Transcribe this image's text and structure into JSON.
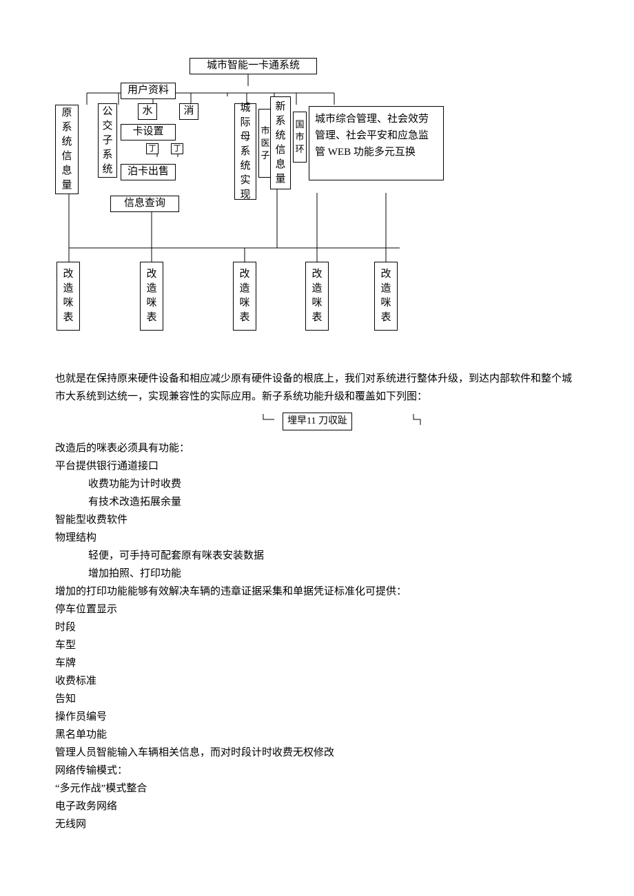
{
  "diagram": {
    "title": "城市智能一卡通系统",
    "userData": "用户资料",
    "cardSetting": "卡设置",
    "cardSale": "泊卡出售",
    "infoQuery": "信息查询",
    "leftTall": "原系统信息量",
    "col_gj": "公交子系统",
    "col_shui": "水",
    "col_xiao": "消",
    "col_shi1": "市",
    "col_shi2": "医",
    "col_zi": "子",
    "col_xi": "系",
    "col_ding": "丁",
    "city_mother": "城际母系统实现",
    "new_sys": "新系统信息量",
    "guo": "国",
    "shi3": "市",
    "huan": "环",
    "right_text": "城市综合管理、社会效劳管理、社会平安和应急监管 WEB 功能多元互换",
    "bottom_box": "改造咪表"
  },
  "body": {
    "p1": "也就是在保持原来硬件设备和相应减少原有硬件设备的根底上，我们对系统进行整体升级，到达内部软件和整个城市大系统到达统一，实现兼容性的实际应用。新子系统功能升级和覆盖如下列图：",
    "mini": "埋早11 刀収趾",
    "l1": "改造后的咪表必须具有功能：",
    "l2": "平台提供银行通道接口",
    "l3": "收费功能为计时收费",
    "l4": "有技术改造拓展余量",
    "l5": "智能型收费软件",
    "l6": "物理结构",
    "l7": "轻便，可手持可配套原有咪表安装数据",
    "l8": "增加拍照、打印功能",
    "l9": "增加的打印功能能够有效解决车辆的违章证据采集和单据凭证标准化可提供：",
    "l10": "停车位置显示",
    "l11": "时段",
    "l12": "车型",
    "l13": "车牌",
    "l14": "收费标准",
    "l15": "告知",
    "l16": "操作员编号",
    "l17": "黑名单功能",
    "l18": "管理人员智能输入车辆相关信息，而对时段计时收费无权修改",
    "l19": "网络传输模式：",
    "l20": "“多元作战”模式整合",
    "l21": "电子政务网络",
    "l22": "无线网"
  }
}
